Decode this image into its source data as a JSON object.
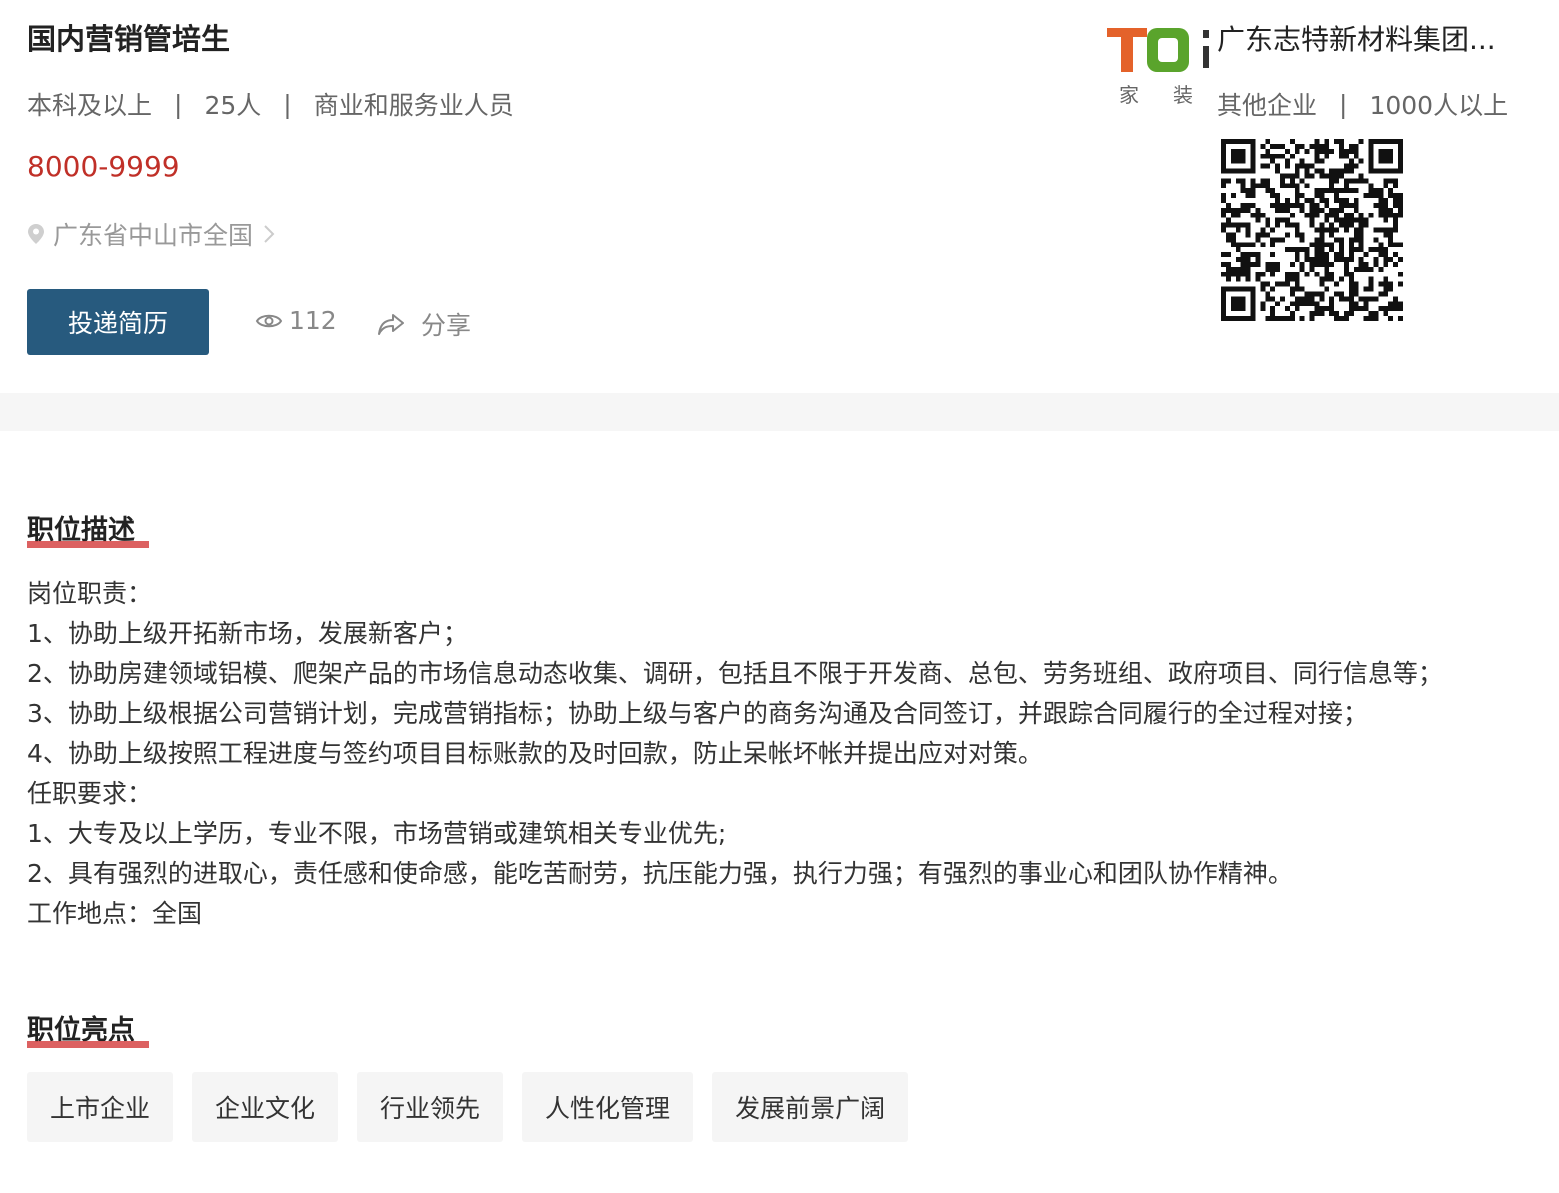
{
  "job": {
    "title": "国内营销管培生",
    "education": "本科及以上",
    "headcount": "25人",
    "category": "商业和服务业人员",
    "separator": "|",
    "salary": "8000-9999",
    "location": "广东省中山市全国",
    "apply_label": "投递简历",
    "views": "112",
    "share_label": "分享"
  },
  "company": {
    "logo_text": "TO",
    "logo_caption_left": "家",
    "logo_caption_right": "装",
    "name": "广东志特新材料集团...",
    "type": "其他企业",
    "size": "1000人以上"
  },
  "description": {
    "heading": "职位描述",
    "lines": [
      "岗位职责：",
      "1、协助上级开拓新市场，发展新客户；",
      "2、协助房建领域铝模、爬架产品的市场信息动态收集、调研，包括且不限于开发商、总包、劳务班组、政府项目、同行信息等；",
      "3、协助上级根据公司营销计划，完成营销指标；协助上级与客户的商务沟通及合同签订，并跟踪合同履行的全过程对接；",
      "4、协助上级按照工程进度与签约项目目标账款的及时回款，防止呆帐坏帐并提出应对对策。",
      "任职要求：",
      "1、大专及以上学历，专业不限，市场营销或建筑相关专业优先;",
      "2、具有强烈的进取心，责任感和使命感，能吃苦耐劳，抗压能力强，执行力强；有强烈的事业心和团队协作精神。",
      "工作地点：全国"
    ]
  },
  "highlights": {
    "heading": "职位亮点",
    "tags": [
      "上市企业",
      "企业文化",
      "行业领先",
      "人性化管理",
      "发展前景广阔"
    ]
  },
  "colors": {
    "salary": "#c03028",
    "apply_button": "#275a7e",
    "heading_underline": "#d64545",
    "logo_orange": "#e4622a",
    "logo_green": "#5aa42c"
  },
  "icons": {
    "location": "map-pin-icon",
    "location_more": "chevron-right-icon",
    "views": "eye-icon",
    "share": "share-arrow-icon"
  }
}
